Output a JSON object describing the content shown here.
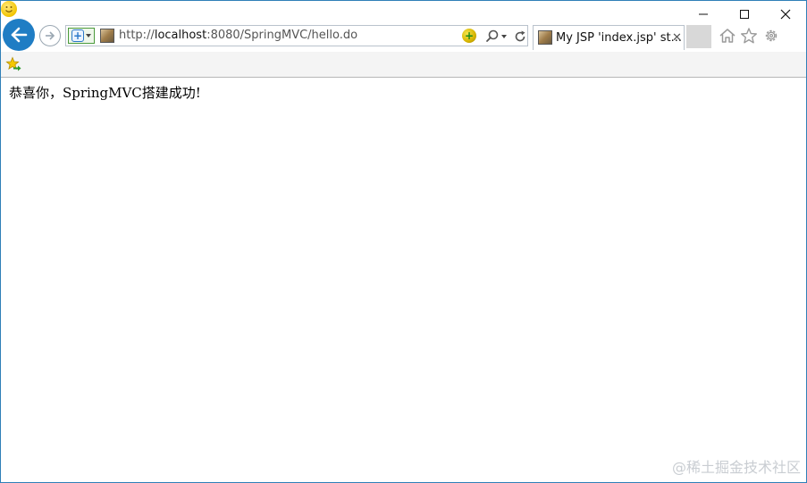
{
  "window": {
    "controls": {
      "minimize": "minimize-icon",
      "maximize": "maximize-icon",
      "close": "close-icon"
    }
  },
  "nav": {
    "back": "back-arrow-icon",
    "forward": "forward-arrow-icon"
  },
  "address_bar": {
    "url_prefix": "http://",
    "url_host": "localhost",
    "url_rest": ":8080/SpringMVC/hello.do"
  },
  "tab": {
    "title": "My JSP 'index.jsp' st...",
    "close_label": "✕"
  },
  "page": {
    "message": "恭喜你，SpringMVC搭建成功!"
  },
  "watermark": "@稀土掘金技术社区",
  "colors": {
    "accent": "#1f7dc4",
    "window_border": "#2f7fb8"
  }
}
